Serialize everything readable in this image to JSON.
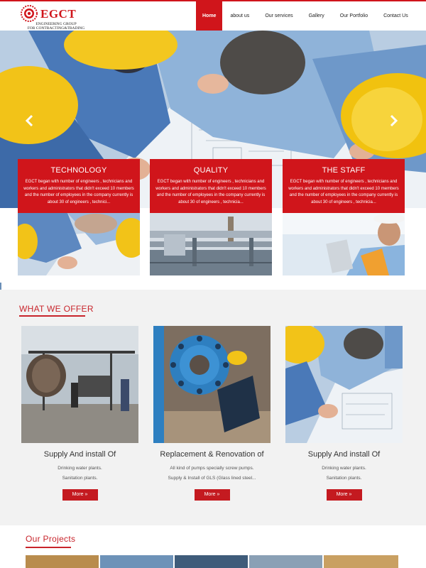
{
  "brand": {
    "name": "EGCT",
    "subtitle_line1": "ENGINEERING GROUP",
    "subtitle_line2": "FOR CONTRACTING&TRADING"
  },
  "nav": {
    "items": [
      {
        "label": "Home",
        "active": true
      },
      {
        "label": "about us",
        "active": false
      },
      {
        "label": "Our services",
        "active": false
      },
      {
        "label": "Gallery",
        "active": false
      },
      {
        "label": "Our Portfolio",
        "active": false
      },
      {
        "label": "Contact Us",
        "active": false
      }
    ]
  },
  "hero": {
    "prev_icon": "chevron-left-icon",
    "next_icon": "chevron-right-icon"
  },
  "features": [
    {
      "title": "TECHNOLOGY",
      "text": "EGCT began with number of engineers , technicians and workers and administrators that didn't exceed 10 members and the number of employees in the company currently is about 30 of engineers , technici..."
    },
    {
      "title": "QUALITY",
      "text": "EGCT began with number of engineers , technicians and workers and administrators that didn't exceed 10 members and the number of employees in the company currently is about 30 of engineers , technicia..."
    },
    {
      "title": "THE STAFF",
      "text": "EGCT began with number of engineers , technicians and workers and administrators that didn't exceed 10 members and the number of employees in the company currently is about 30 of engineers , technicia..."
    }
  ],
  "offer": {
    "title": "WHAT WE OFFER",
    "items": [
      {
        "title": "Supply And install Of",
        "line1": "Drinking water plants.",
        "line2": "Sanitation plants.",
        "button": "More »"
      },
      {
        "title": "Replacement & Renovation of",
        "line1": "All kind of pumps specially screw pumps.",
        "line2": "Supply & Install of GLS (Glass lined steel...",
        "button": "More »"
      },
      {
        "title": "Supply And install Of",
        "line1": "Drinking water plants.",
        "line2": "Sanitation plants.",
        "button": "More »"
      }
    ]
  },
  "projects": {
    "title": "Our Projects"
  },
  "colors": {
    "accent": "#d0151b",
    "section_bg": "#f2f2f2",
    "title_red": "#c8242b"
  }
}
